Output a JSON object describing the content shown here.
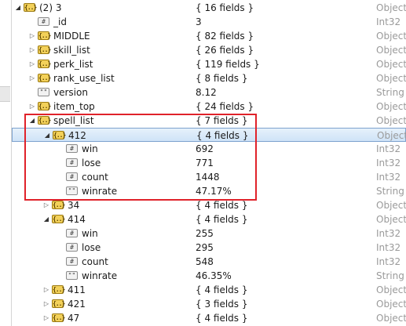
{
  "rows": [
    {
      "depth": 0,
      "arrow": "open",
      "icon": "obj",
      "name": "(2) 3",
      "value": "{ 16 fields }",
      "type": "Object"
    },
    {
      "depth": 1,
      "arrow": "none",
      "icon": "int",
      "name": "_id",
      "value": "3",
      "type": "Int32"
    },
    {
      "depth": 1,
      "arrow": "closed",
      "icon": "obj",
      "name": "MIDDLE",
      "value": "{ 82 fields }",
      "type": "Object"
    },
    {
      "depth": 1,
      "arrow": "closed",
      "icon": "obj",
      "name": "skill_list",
      "value": "{ 26 fields }",
      "type": "Object"
    },
    {
      "depth": 1,
      "arrow": "closed",
      "icon": "obj",
      "name": "perk_list",
      "value": "{ 119 fields }",
      "type": "Object"
    },
    {
      "depth": 1,
      "arrow": "closed",
      "icon": "obj",
      "name": "rank_use_list",
      "value": "{ 8 fields }",
      "type": "Object"
    },
    {
      "depth": 1,
      "arrow": "none",
      "icon": "str",
      "name": "version",
      "value": "8.12",
      "type": "String"
    },
    {
      "depth": 1,
      "arrow": "closed",
      "icon": "obj",
      "name": "item_top",
      "value": "{ 24 fields }",
      "type": "Object"
    },
    {
      "depth": 1,
      "arrow": "open",
      "icon": "obj",
      "name": "spell_list",
      "value": "{ 7 fields }",
      "type": "Object"
    },
    {
      "depth": 2,
      "arrow": "open",
      "icon": "obj",
      "name": "412",
      "value": "{ 4 fields }",
      "type": "Object",
      "selected": true
    },
    {
      "depth": 3,
      "arrow": "none",
      "icon": "int",
      "name": "win",
      "value": "692",
      "type": "Int32"
    },
    {
      "depth": 3,
      "arrow": "none",
      "icon": "int",
      "name": "lose",
      "value": "771",
      "type": "Int32"
    },
    {
      "depth": 3,
      "arrow": "none",
      "icon": "int",
      "name": "count",
      "value": "1448",
      "type": "Int32"
    },
    {
      "depth": 3,
      "arrow": "none",
      "icon": "str",
      "name": "winrate",
      "value": "47.17%",
      "type": "String"
    },
    {
      "depth": 2,
      "arrow": "closed",
      "icon": "obj",
      "name": "34",
      "value": "{ 4 fields }",
      "type": "Object"
    },
    {
      "depth": 2,
      "arrow": "open",
      "icon": "obj",
      "name": "414",
      "value": "{ 4 fields }",
      "type": "Object"
    },
    {
      "depth": 3,
      "arrow": "none",
      "icon": "int",
      "name": "win",
      "value": "255",
      "type": "Int32"
    },
    {
      "depth": 3,
      "arrow": "none",
      "icon": "int",
      "name": "lose",
      "value": "295",
      "type": "Int32"
    },
    {
      "depth": 3,
      "arrow": "none",
      "icon": "int",
      "name": "count",
      "value": "548",
      "type": "Int32"
    },
    {
      "depth": 3,
      "arrow": "none",
      "icon": "str",
      "name": "winrate",
      "value": "46.35%",
      "type": "String"
    },
    {
      "depth": 2,
      "arrow": "closed",
      "icon": "obj",
      "name": "411",
      "value": "{ 4 fields }",
      "type": "Object"
    },
    {
      "depth": 2,
      "arrow": "closed",
      "icon": "obj",
      "name": "421",
      "value": "{ 3 fields }",
      "type": "Object"
    },
    {
      "depth": 2,
      "arrow": "closed",
      "icon": "obj",
      "name": "47",
      "value": "{ 4 fields }",
      "type": "Object"
    }
  ],
  "icons": {
    "obj": "{..}",
    "int": "#",
    "str": "\"\""
  },
  "colors": {
    "highlight_box": "#e0222a",
    "selection": "#cfe3f7",
    "type_text": "#9a9a9a"
  }
}
